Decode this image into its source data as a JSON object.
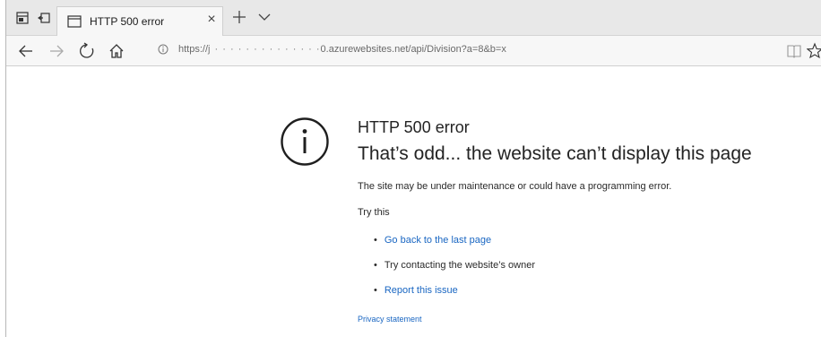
{
  "tab": {
    "title": "HTTP 500 error",
    "close_glyph": "×"
  },
  "address": {
    "prefix": "https://",
    "obscured": "j ·  · · · · ·  · · · · · · ·  ·",
    "suffix": "0.azurewebsites.net/api/Division?a=8&b=x"
  },
  "error": {
    "title": "HTTP 500 error",
    "subtitle": "That’s odd... the website can’t display this page",
    "description": "The site may be under maintenance or could have a programming error.",
    "try_this": "Try this",
    "suggestions": [
      {
        "bullet": "•",
        "text": "Go back to the last page",
        "is_link": true
      },
      {
        "bullet": "•",
        "text": "Try contacting the website’s owner",
        "is_link": false
      },
      {
        "bullet": "•",
        "text": "Report this issue",
        "is_link": true
      }
    ],
    "privacy": "Privacy statement"
  },
  "colors": {
    "link": "#1966c2",
    "tabstrip": "#e8e8e8",
    "toolbar": "#f7f7f7"
  },
  "icons": [
    "tab-preview-icon",
    "set-aside-icon",
    "tab-page-icon",
    "close-icon",
    "new-tab-icon",
    "tab-menu-chevron-icon",
    "back-arrow-icon",
    "forward-arrow-icon",
    "refresh-icon",
    "home-icon",
    "info-icon",
    "reading-view-icon",
    "favorite-star-icon",
    "error-info-icon"
  ]
}
